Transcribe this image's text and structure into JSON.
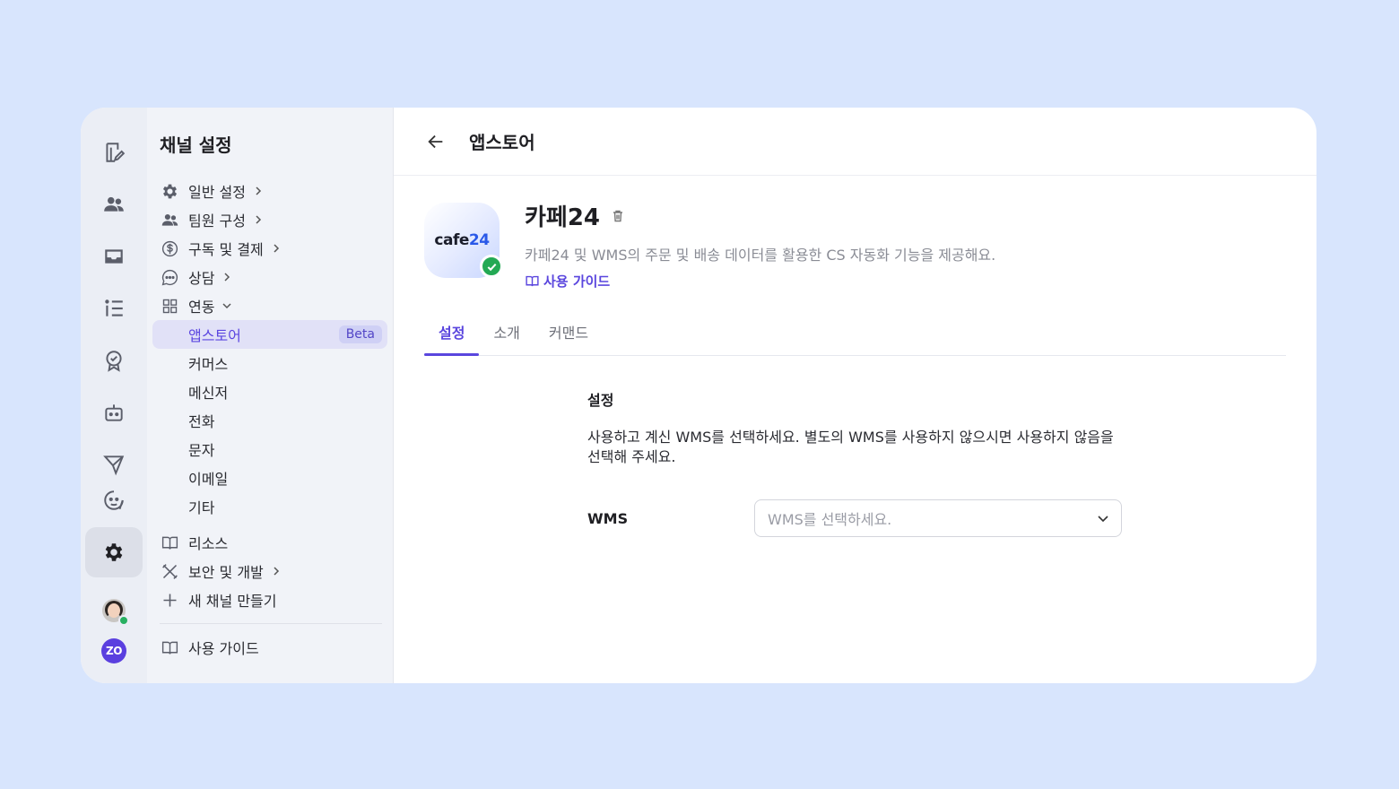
{
  "rail": {
    "items": [
      "edit-note-icon",
      "people-icon",
      "inbox-icon",
      "list-icon",
      "badge-icon",
      "bot-icon",
      "send-icon",
      "face-icon",
      "gear-icon"
    ],
    "active": "gear-icon",
    "brand_badge": "ZO"
  },
  "sidebar": {
    "title": "채널 설정",
    "items": [
      {
        "label": "일반 설정",
        "icon": "gear-icon"
      },
      {
        "label": "팀원 구성",
        "icon": "people-icon"
      },
      {
        "label": "구독 및 결제",
        "icon": "dollar-circle-icon"
      },
      {
        "label": "상담",
        "icon": "chat-bubble-icon"
      },
      {
        "label": "연동",
        "icon": "grid-icon"
      }
    ],
    "sub_items": [
      "앱스토어",
      "커머스",
      "메신저",
      "전화",
      "문자",
      "이메일",
      "기타"
    ],
    "beta_badge": "Beta",
    "lower_items": [
      {
        "label": "리소스",
        "icon": "book-icon"
      },
      {
        "label": "보안 및 개발",
        "icon": "tools-icon"
      },
      {
        "label": "새 채널 만들기",
        "icon": "plus-icon"
      }
    ],
    "footer_item": {
      "label": "사용 가이드",
      "icon": "book-icon"
    }
  },
  "header": {
    "title": "앱스토어"
  },
  "app": {
    "logo_text_dark": "cafe",
    "logo_text_blue": "24",
    "name": "카페24",
    "description": "카페24 및 WMS의 주문 및 배송 데이터를 활용한 CS 자동화 기능을 제공해요.",
    "guide_label": "사용 가이드"
  },
  "tabs": [
    "설정",
    "소개",
    "커맨드"
  ],
  "settings": {
    "title": "설정",
    "description": "사용하고 계신 WMS를 선택하세요. 별도의 WMS를 사용하지 않으시면 사용하지 않음을 선택해 주세요.",
    "field_label": "WMS",
    "select_placeholder": "WMS를 선택하세요."
  },
  "colors": {
    "accent": "#5a46de",
    "background": "#d8e5fd",
    "success": "#23a954"
  }
}
